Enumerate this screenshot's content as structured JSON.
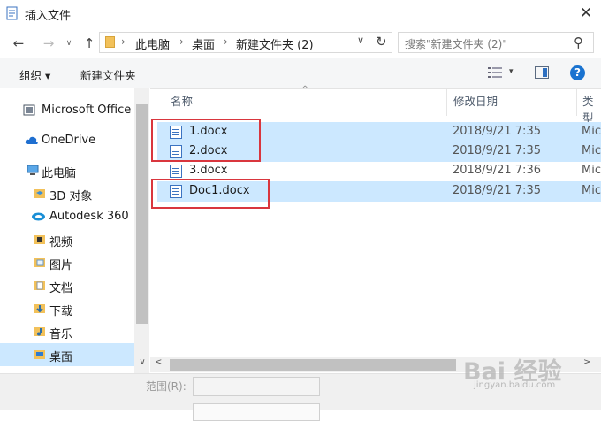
{
  "window": {
    "title": "插入文件"
  },
  "nav": {
    "back": "←",
    "forward": "→",
    "up": "↑"
  },
  "address": {
    "crumbs": [
      "此电脑",
      "桌面",
      "新建文件夹 (2)"
    ],
    "separator": "›",
    "dropdown": "∨",
    "refresh": "↻"
  },
  "search": {
    "placeholder": "搜索\"新建文件夹 (2)\"",
    "icon": "search-icon"
  },
  "toolbar": {
    "organize": "组织 ▾",
    "new_folder": "新建文件夹",
    "view_dropdown": "▾",
    "help": "?"
  },
  "sidebar": {
    "items": [
      {
        "label": "Microsoft Office",
        "icon": "office-icon"
      },
      {
        "label": "OneDrive",
        "icon": "cloud-icon"
      },
      {
        "label": "此电脑",
        "icon": "computer-icon"
      },
      {
        "label": "3D 对象",
        "icon": "folder-3d-icon"
      },
      {
        "label": "Autodesk 360",
        "icon": "autodesk-icon"
      },
      {
        "label": "视频",
        "icon": "video-folder-icon"
      },
      {
        "label": "图片",
        "icon": "pictures-folder-icon"
      },
      {
        "label": "文档",
        "icon": "documents-folder-icon"
      },
      {
        "label": "下载",
        "icon": "downloads-folder-icon"
      },
      {
        "label": "音乐",
        "icon": "music-folder-icon"
      },
      {
        "label": "桌面",
        "icon": "desktop-folder-icon",
        "selected": true
      }
    ]
  },
  "columns": {
    "name": "名称",
    "modified": "修改日期",
    "type": "类型"
  },
  "files": [
    {
      "name": "1.docx",
      "modified": "2018/9/21 7:35",
      "type": "Mic",
      "selected": true
    },
    {
      "name": "2.docx",
      "modified": "2018/9/21 7:35",
      "type": "Mic",
      "selected": true
    },
    {
      "name": "3.docx",
      "modified": "2018/9/21 7:36",
      "type": "Mic",
      "selected": false
    },
    {
      "name": "Doc1.docx",
      "modified": "2018/9/21 7:35",
      "type": "Mic",
      "selected": true
    }
  ],
  "footer": {
    "range_label": "范围(R):"
  },
  "watermark": {
    "main": "Bai 经验",
    "sub": "jingyan.baidu.com"
  },
  "colors": {
    "selection": "#cce8ff",
    "highlight_box": "#d9363e",
    "accent": "#1a73d0"
  }
}
